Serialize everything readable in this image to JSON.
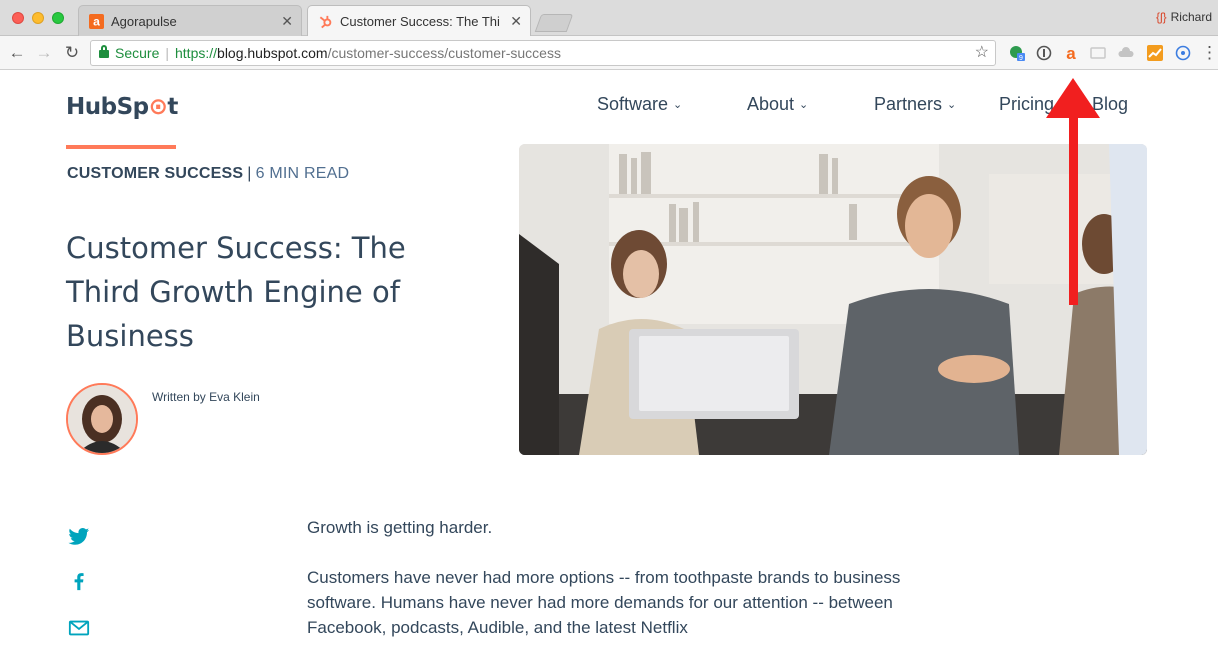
{
  "browser": {
    "tabs": [
      {
        "title": "Agorapulse",
        "active": false
      },
      {
        "title": "Customer Success: The Third G",
        "active": true
      }
    ],
    "profile_name": "Richard",
    "security_label": "Secure",
    "url_scheme": "https://",
    "url_host": "blog.hubspot.com",
    "url_path": "/customer-success/customer-success",
    "extension_badge": "9"
  },
  "site": {
    "logo_text_a": "HubSp",
    "logo_text_b": "t",
    "nav": [
      {
        "label": "Software",
        "has_dropdown": true
      },
      {
        "label": "About",
        "has_dropdown": true
      },
      {
        "label": "Partners",
        "has_dropdown": true
      },
      {
        "label": "Pricing",
        "has_dropdown": false
      },
      {
        "label": "Blog",
        "has_dropdown": false
      }
    ]
  },
  "article": {
    "topic": "CUSTOMER SUCCESS",
    "separator": "|",
    "read_time": "6 MIN READ",
    "title": "Customer Success: The Third Growth Engine of Business",
    "byline": "Written by Eva Klein",
    "paragraphs": [
      "Growth is getting harder.",
      "Customers have never had more options -- from toothpaste brands to business software. Humans have never had more demands for our attention -- between Facebook, podcasts, Audible, and the latest Netflix"
    ]
  },
  "colors": {
    "brand_orange": "#ff7a59",
    "text_dark": "#33475b",
    "social_blue": "#00a4bd",
    "annotation_red": "#f11f1f"
  }
}
